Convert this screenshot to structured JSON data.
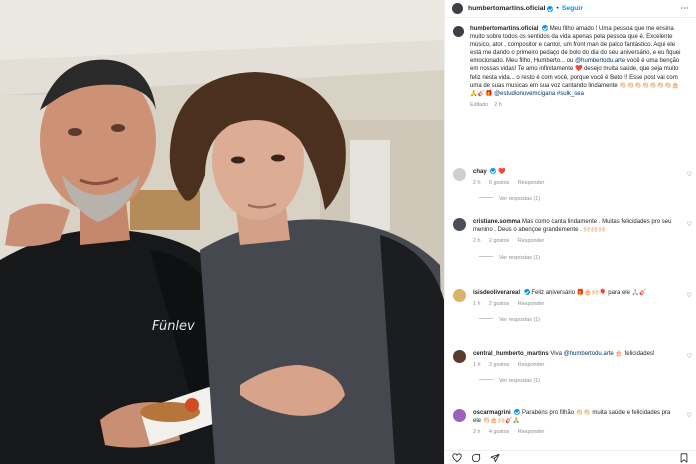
{
  "post": {
    "username": "humbertomartins.oficial",
    "follow_label": "Seguir",
    "caption_text": "Meu filho amado ! Uma pessoa que me ensina muito sobre todos os sentidos da vida apenas pela pessoa que é. Excelente músico, ator , compositor e cantor, um front man de palco fantástico. Aqui ele está me dando o primeiro pedaço de bolo do dia do seu aniversário, e eu fiquei emocionado. Meu filho, Humberto... ou",
    "caption_mention_1": "@humbertodu.arte",
    "caption_text_2": "você é uma benção em nossas vidas! Te amo infinitamente ❤️ desejo muita saúde, que seja muito feliz nesta vida... o resto é com você, porque você é Beto !! Esse post vai com uma de suas musicas em sua voz cantando lindamente 👏🏻👏🏻👏🏻👏🏻👏🏻👏🏻👏🏻🎂🙏🎸🎁",
    "caption_mention_2": "@estudionuvemcigana #sulk_sea",
    "edited_label": "Editado",
    "edited_time": "2 h",
    "shirt_text": "Fünlev"
  },
  "comments": [
    {
      "user": "chay",
      "verified": true,
      "text": "❤️",
      "time": "2 h",
      "likes": "6 gostos",
      "reply": "Responder",
      "replies": "Ver respostas (1)"
    },
    {
      "user": "cristiane.somma",
      "verified": false,
      "text": "Mas como canta lindamente . Muitas felicidades pro seu menino . Deus o abençoe grandemente . 🙌🏻🙌🏻🙌🏻",
      "time": "2 h",
      "likes": "2 gostos",
      "reply": "Responder",
      "replies": "Ver respostas (1)"
    },
    {
      "user": "isisdeoliverareal",
      "verified": true,
      "text": "Feliz aniversário 🎁🎂🙌🏻🎈 para ele 🙏🏻🎸",
      "time": "1 h",
      "likes": "2 gostos",
      "reply": "Responder",
      "replies": "Ver respostas (1)"
    },
    {
      "user": "central_humberto_martins",
      "verified": false,
      "text": "Viva",
      "mention": "@humbertodu.arte",
      "text_after": "🎂 felicidades!",
      "time": "1 h",
      "likes": "2 gostos",
      "reply": "Responder",
      "replies": "Ver respostas (1)"
    },
    {
      "user": "oscarmagrini",
      "verified": true,
      "text": "Parabéns pro filhão 👏🏻👏🏻 muita saúde e felicidades pra ele 👏🏻🎂🙌🏻🎸🙏",
      "time": "2 h",
      "likes": "4 gostos",
      "reply": "Responder",
      "replies": ""
    }
  ],
  "icons": {
    "header_more": "more-horizontal-icon",
    "comment_like": "heart-outline-icon",
    "like": "heart-icon",
    "comment": "comment-icon",
    "share": "send-icon",
    "save": "bookmark-icon"
  },
  "colors": {
    "link_blue": "#0095f6",
    "mention": "#00376b",
    "muted": "#8e8e8e"
  }
}
